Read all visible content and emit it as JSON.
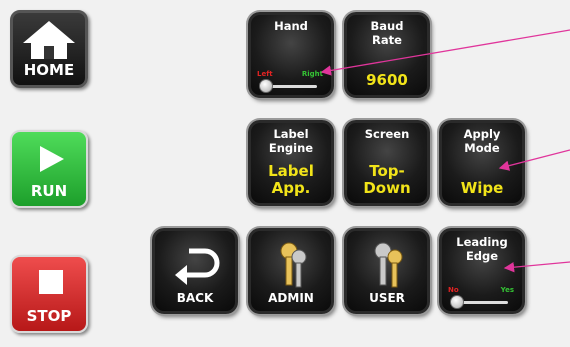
{
  "side": {
    "home": "HOME",
    "run": "RUN",
    "stop": "STOP"
  },
  "tiles": {
    "hand": {
      "title": "Hand",
      "low": "Left",
      "high": "Right"
    },
    "baud": {
      "title": "Baud Rate",
      "value": "9600"
    },
    "label_engine": {
      "title": "Label Engine",
      "value": "Label App."
    },
    "screen": {
      "title": "Screen",
      "value": "Top-Down"
    },
    "apply_mode": {
      "title": "Apply Mode",
      "value": "Wipe"
    },
    "back": {
      "label": "BACK"
    },
    "admin": {
      "label": "ADMIN"
    },
    "user": {
      "label": "USER"
    },
    "leading_edge": {
      "title": "Leading Edge",
      "low": "No",
      "high": "Yes"
    }
  },
  "colors": {
    "value_yellow": "#f2e419",
    "run_green": "#1d9f2b",
    "stop_red": "#b71818",
    "callout_magenta": "#e0359b"
  },
  "icons": {
    "home": "house-icon",
    "run": "play-icon",
    "stop": "stop-square-icon",
    "back": "return-arrow-icon",
    "admin": "keys-icon",
    "user": "keys-icon"
  }
}
